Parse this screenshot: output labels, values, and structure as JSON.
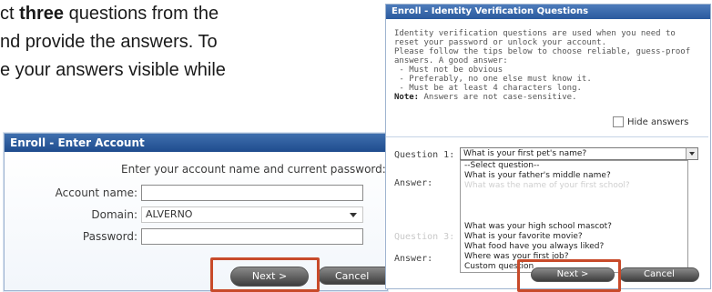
{
  "background_text": {
    "line1_pre": "ct ",
    "line1_bold": "three",
    "line1_post": " questions from the",
    "line2": "nd provide the answers.  To",
    "line3": "e your answers visible while"
  },
  "account_panel": {
    "title": "Enroll - Enter Account",
    "prompt": "Enter your account name and current password:",
    "account_label": "Account name:",
    "account_value": "",
    "domain_label": "Domain:",
    "domain_value": "ALVERNO",
    "password_label": "Password:",
    "password_value": "",
    "next_label": "Next >",
    "cancel_label": "Cancel"
  },
  "id_panel": {
    "title": "Enroll - Identity Verification Questions",
    "description": [
      "Identity verification questions are used when you need to",
      "reset your password or unlock your account.",
      "Please follow the tips below to choose reliable, guess-proof",
      "answers. A good answer:",
      " - Must not be obvious",
      " - Preferably, no one else must know it.",
      " - Must be at least 4 characters long."
    ],
    "note_label": "Note:",
    "note_text": " Answers are not case-sensitive.",
    "hide_answers": "Hide answers",
    "hide_checked": false,
    "question1_label": "Question 1:",
    "question1_value": "What is your first pet's name?",
    "answer_label": "Answer:",
    "question3_label": "Question 3:",
    "answer3_label": "Answer:",
    "dropdown_options": [
      "--Select question--",
      "What is your father's middle name?",
      "What was the name of your first school?",
      "What was your high school mascot?",
      "What is your favorite movie?",
      "What food have you always liked?",
      "Where was your first job?",
      "Custom question"
    ],
    "next_label": "Next >",
    "cancel_label": "Cancel"
  },
  "colors": {
    "title_bar": "#2a5a9e",
    "highlight": "#c84a2a",
    "button": "#5a5a5a"
  }
}
